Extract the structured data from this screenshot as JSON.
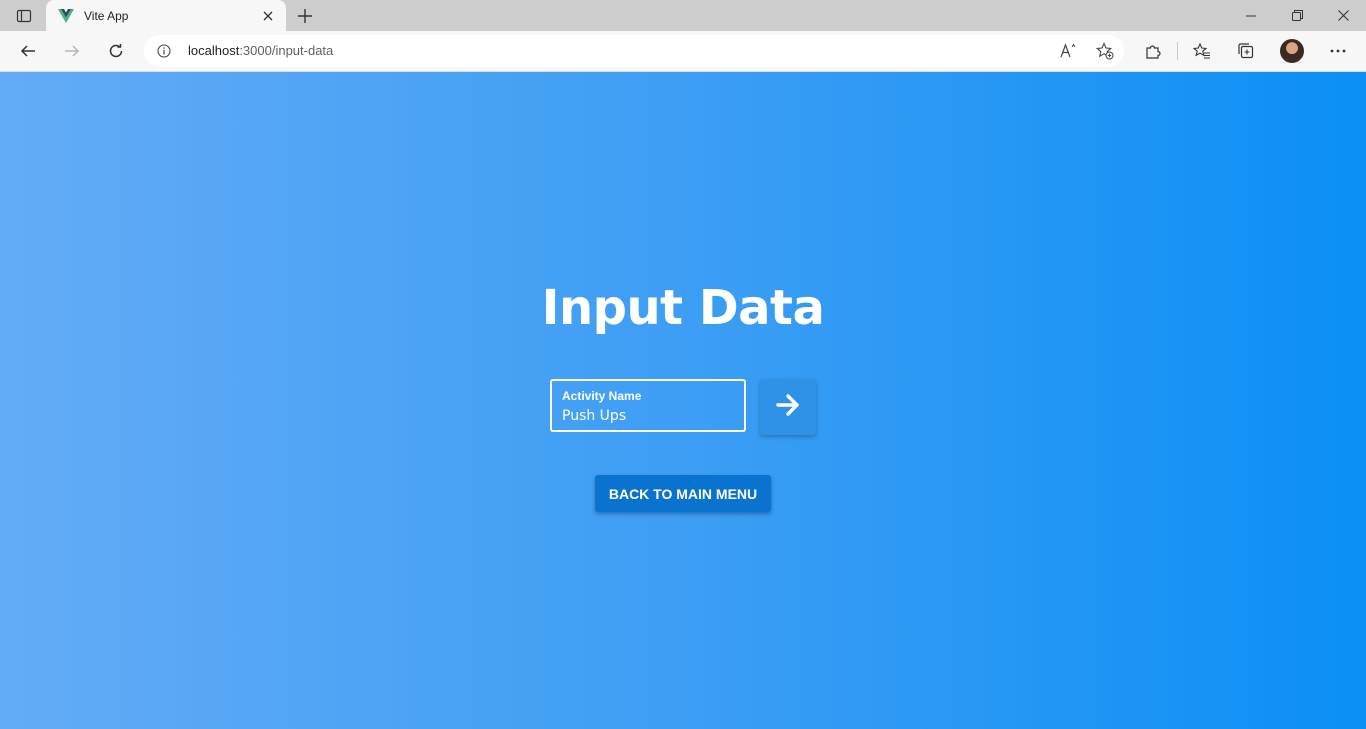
{
  "browser": {
    "tab_title": "Vite App",
    "url_host": "localhost",
    "url_path": ":3000/input-data",
    "icons": {
      "tab_actions": "tab-actions-icon",
      "favicon": "vue-logo-icon",
      "tab_close": "close-icon",
      "new_tab": "plus-icon",
      "minimize": "minimize-icon",
      "restore": "restore-icon",
      "close_window": "close-icon",
      "back": "back-arrow-icon",
      "forward": "forward-arrow-icon",
      "refresh": "refresh-icon",
      "site_info": "info-icon",
      "read_aloud": "read-aloud-icon",
      "add_favorite": "add-favorite-icon",
      "extensions": "puzzle-icon",
      "favorites": "favorites-icon",
      "collections": "collections-icon",
      "more": "more-icon"
    }
  },
  "page": {
    "title": "Input Data",
    "activity_field": {
      "label": "Activity Name",
      "value": "Push Ups"
    },
    "submit_icon": "arrow-right-icon",
    "back_button_label": "BACK TO MAIN MENU"
  },
  "colors": {
    "gradient_start": "#63abf6",
    "gradient_end": "#0b8ff5",
    "submit_button": "#2f92e7",
    "back_button": "#0a73cf"
  }
}
